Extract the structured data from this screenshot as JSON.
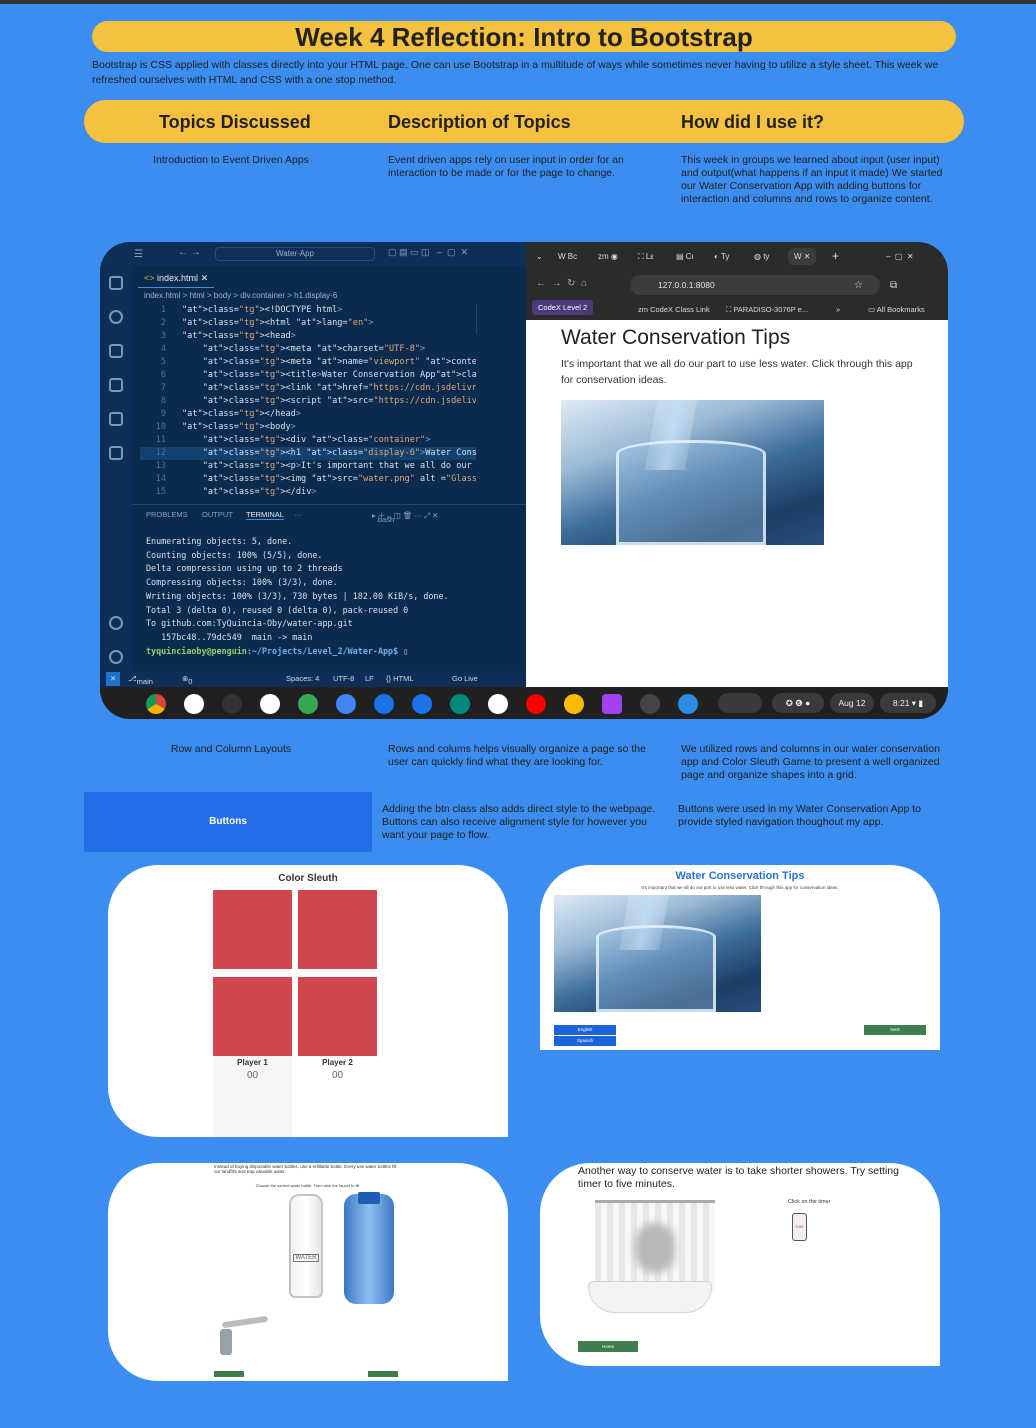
{
  "page": {
    "title": "Week 4 Reflection: Intro to Bootstrap",
    "intro": "Bootstrap is CSS applied with classes directly into your HTML page. One can use Bootstrap in a multitude of ways while sometimes never having to utilize a style sheet. This week we refreshed ourselves with HTML and CSS with a one stop method."
  },
  "table": {
    "headers": [
      "Topics Discussed",
      "Description of Topics",
      "How did I use it?"
    ],
    "rows": [
      {
        "topic": "Introduction to Event Driven Apps",
        "description": "Event driven apps rely on user input in order for an interaction to be made or for the page to change.",
        "usage": "This week in groups we learned about input (user input) and output(what happens if an input it made) We started our Water Conservation App with adding buttons for interaction and columns and rows to organize content."
      },
      {
        "topic": "Row and Column Layouts",
        "description": "Rows and colums helps visually organize a page so the user can quickly find what they are looking for.",
        "usage": "We utilized rows and columns in our water conservation app and Color Sleuth Game to present a well organized page and organize shapes into a grid."
      },
      {
        "topic": "Buttons",
        "description": "Adding the btn class also adds direct style to the webpage. Buttons can also receive alignment style for however you want your page to flow.",
        "usage": "Buttons were used in my Water Conservation App to provide styled navigation thoughout my app."
      }
    ]
  },
  "editor": {
    "search": "Water-App",
    "tab": "index.html",
    "breadcrumb": "index.html > html > body > div.container > h1.display-6",
    "lines": [
      {
        "n": "1",
        "t": "<!DOCTYPE html>"
      },
      {
        "n": "2",
        "t": "<html lang=\"en\">"
      },
      {
        "n": "3",
        "t": "<head>"
      },
      {
        "n": "4",
        "t": "    <meta charset=\"UTF-8\">"
      },
      {
        "n": "5",
        "t": "    <meta name=\"viewport\" content=\"width=device-wic"
      },
      {
        "n": "6",
        "t": "    <title>Water Conservation App</title>"
      },
      {
        "n": "7",
        "t": "    <link href=\"https://cdn.jsdelivr.net/npm/bootst"
      },
      {
        "n": "8",
        "t": "    <script src=\"https://cdn.jsdelivr.net/npm/boots"
      },
      {
        "n": "9",
        "t": "</head>"
      },
      {
        "n": "10",
        "t": "<body>"
      },
      {
        "n": "11",
        "t": "    <div class=\"container\">"
      },
      {
        "n": "12",
        "t": "    <h1 class=\"display-6\">Water Conservation Tips</"
      },
      {
        "n": "13",
        "t": "    <p>It's important that we all do our part to us"
      },
      {
        "n": "14",
        "t": "    <img src=\"water.png\" alt =\"Glass of water\">"
      },
      {
        "n": "15",
        "t": "    </div>"
      }
    ],
    "panel_tabs": [
      "PROBLEMS",
      "OUTPUT",
      "TERMINAL"
    ],
    "shell": "bash",
    "terminal": [
      "Enumerating objects: 5, done.",
      "Counting objects: 100% (5/5), done.",
      "Delta compression using up to 2 threads",
      "Compressing objects: 100% (3/3), done.",
      "Writing objects: 100% (3/3), 730 bytes | 182.00 KiB/s, done.",
      "Total 3 (delta 0), reused 0 (delta 0), pack-reused 0",
      "To github.com:TyQuincia-Oby/water-app.git",
      "   157bc48..79dc549  main -> main"
    ],
    "prompt_user": "tyquinciaoby@penguin",
    "prompt_path": ":~/Projects/Level_2/Water-App$",
    "status": {
      "branch": "main",
      "problems": "0 ⚠ 0",
      "spaces": "Spaces: 4",
      "encoding": "UTF-8",
      "eol": "LF",
      "lang": "{} HTML",
      "golive": "Go Live"
    }
  },
  "browser": {
    "url": "127.0.0.1:8080",
    "bookmarks": [
      "CodeX Level 2",
      "CodeX Class Link",
      "PARADISO-3076P e...",
      "All Bookmarks"
    ],
    "heading": "Water Conservation Tips",
    "paragraph": "It's important that we all do our part to use less water. Click through this app for conservation ideas."
  },
  "taskbar": {
    "date": "Aug 12",
    "time": "8:21"
  },
  "color_sleuth": {
    "title": "Color Sleuth",
    "player1": "Player 1",
    "player2": "Player 2",
    "score1": "00",
    "score2": "00"
  },
  "water_app": {
    "title": "Water Conservation Tips",
    "text": "It's important that we all do our part to use less water. Click through this app for conservation ideas.",
    "lang1": "English",
    "lang2": "Spanish",
    "next": "Next"
  },
  "bottles": {
    "text": "Instead of buying disposable water bottles, use a refillable bottle. Every use water bottles fill our landfills and trap valuable water.",
    "hint": "Choose the correct water bottle. Then click the faucet to fill.",
    "label": "WATER"
  },
  "shower": {
    "text": "Another way to conserve water is to take shorter showers. Try setting timer to five minutes.",
    "timer_label": "Click on the timer",
    "timer": "5:00",
    "button": "Home"
  },
  "colors": {
    "background": "#3b8ef0",
    "accent": "#f5c13e",
    "button": "#246ee9",
    "tile": "#d0484e"
  }
}
